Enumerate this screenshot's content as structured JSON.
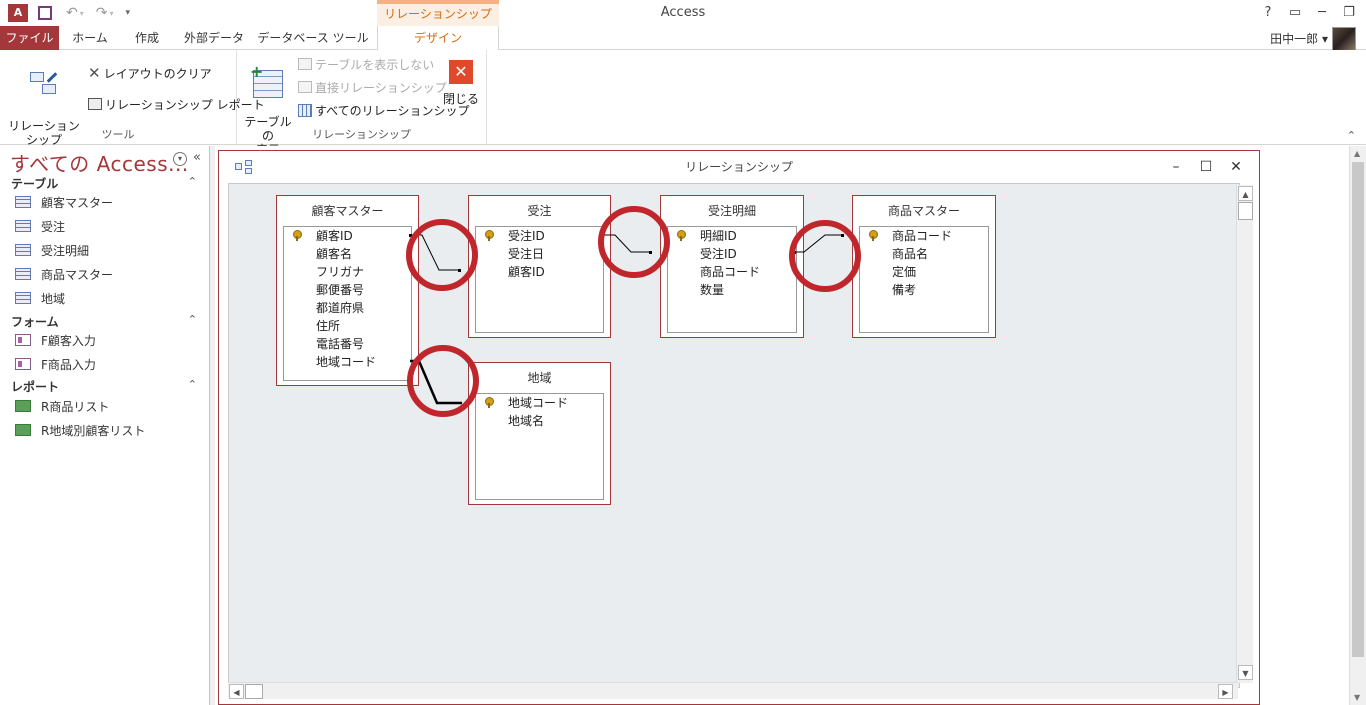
{
  "app": {
    "title": "Access",
    "context_tab_title": "リレーションシップ ツール",
    "help": "?",
    "user": "田中一郎 ▾"
  },
  "tabs": [
    "ファイル",
    "ホーム",
    "作成",
    "外部データ",
    "データベース ツール",
    "デザイン"
  ],
  "ribbon": {
    "tools_group": {
      "label": "ツール",
      "edit_relationships": "リレーションシップ\nの編集",
      "clear_layout": "レイアウトのクリア",
      "relationship_report": "リレーションシップ レポート"
    },
    "relationships_group": {
      "label": "リレーションシップ",
      "show_table": "テーブルの\n表示",
      "hide_table": "テーブルを表示しない",
      "direct_relationships": "直接リレーションシップ",
      "all_relationships": "すべてのリレーションシップ"
    },
    "close": "閉じる"
  },
  "nav": {
    "title": "すべての Access...",
    "sections": [
      {
        "header": "テーブル",
        "items": [
          "顧客マスター",
          "受注",
          "受注明細",
          "商品マスター",
          "地域"
        ]
      },
      {
        "header": "フォーム",
        "items": [
          "F顧客入力",
          "F商品入力"
        ]
      },
      {
        "header": "レポート",
        "items": [
          "R商品リスト",
          "R地域別顧客リスト"
        ]
      }
    ]
  },
  "relationships_window": {
    "title": "リレーションシップ",
    "tables": [
      {
        "name": "顧客マスター",
        "fields": [
          {
            "name": "顧客ID",
            "key": true
          },
          {
            "name": "顧客名"
          },
          {
            "name": "フリガナ"
          },
          {
            "name": "郵便番号"
          },
          {
            "name": "都道府県"
          },
          {
            "name": "住所"
          },
          {
            "name": "電話番号"
          },
          {
            "name": "地域コード"
          }
        ]
      },
      {
        "name": "受注",
        "fields": [
          {
            "name": "受注ID",
            "key": true
          },
          {
            "name": "受注日"
          },
          {
            "name": "顧客ID"
          }
        ]
      },
      {
        "name": "受注明細",
        "fields": [
          {
            "name": "明細ID",
            "key": true
          },
          {
            "name": "受注ID"
          },
          {
            "name": "商品コード"
          },
          {
            "name": "数量"
          }
        ]
      },
      {
        "name": "商品マスター",
        "fields": [
          {
            "name": "商品コード",
            "key": true
          },
          {
            "name": "商品名"
          },
          {
            "name": "定価"
          },
          {
            "name": "備考"
          }
        ]
      },
      {
        "name": "地域",
        "fields": [
          {
            "name": "地域コード",
            "key": true
          },
          {
            "name": "地域名"
          }
        ]
      }
    ]
  },
  "colors": {
    "accent": "#a4373a",
    "context": "#d26b12",
    "highlight_circle": "#c0272d",
    "canvas": "#e9edf0"
  }
}
